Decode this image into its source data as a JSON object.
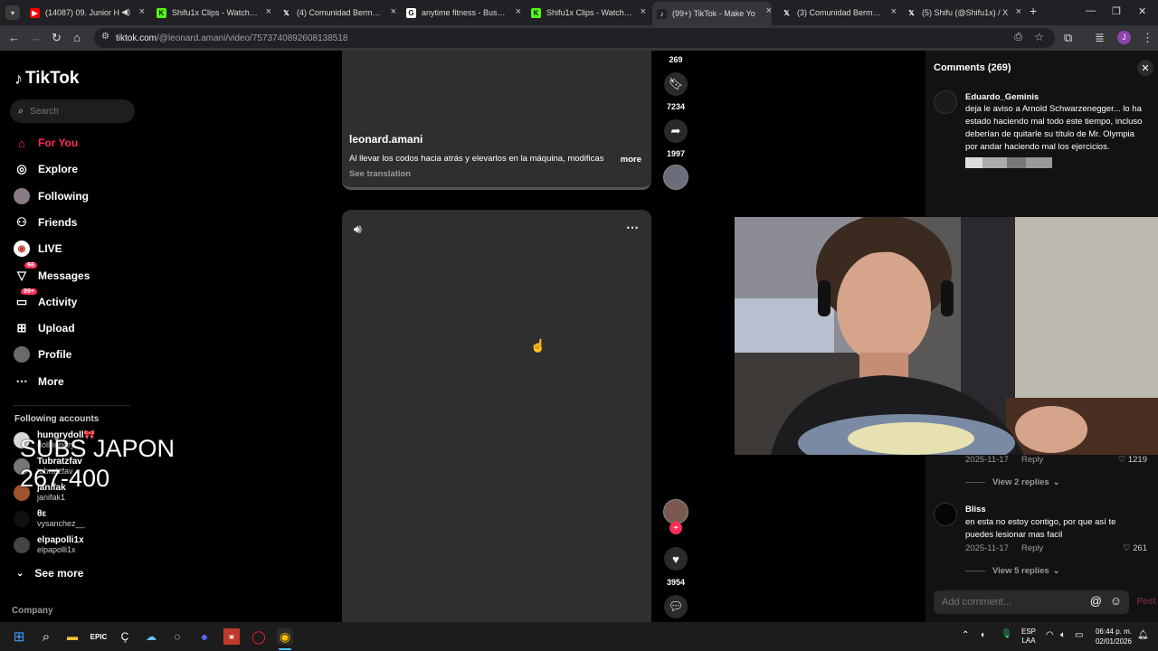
{
  "browser": {
    "tabs": [
      {
        "title": "(14087) 09. Junior H",
        "favicon": "youtube-icon",
        "color": "#ff0000",
        "glyph": "▶",
        "muted": true
      },
      {
        "title": "Shifu1x Clips - Watch Live",
        "favicon": "kick-icon",
        "color": "#53fc18",
        "glyph": "K"
      },
      {
        "title": "(4) Comunidad Bermudez",
        "favicon": "x-icon",
        "color": "#202124",
        "glyph": "𝕏"
      },
      {
        "title": "anytime fitness - Buscar c",
        "favicon": "google-icon",
        "color": "#ffffff",
        "glyph": "G"
      },
      {
        "title": "Shifu1x Clips - Watch Live",
        "favicon": "kick-icon",
        "color": "#53fc18",
        "glyph": "K"
      },
      {
        "title": "(99+) TikTok - Make Yo",
        "favicon": "tiktok-icon",
        "color": "#202124",
        "glyph": "♪",
        "active": true
      },
      {
        "title": "(3) Comunidad Bermudez",
        "favicon": "x-icon",
        "color": "#202124",
        "glyph": "𝕏"
      },
      {
        "title": "(5) Shifu (@Shifu1x) / X",
        "favicon": "x-icon",
        "color": "#202124",
        "glyph": "𝕏"
      }
    ],
    "url_host": "tiktok.com",
    "url_path": "/@leonard.amani/video/7573740892608138518",
    "profile_initial": "J"
  },
  "sidebar": {
    "logo": "TikTok",
    "search_placeholder": "Search",
    "nav": [
      {
        "label": "For You",
        "icon": "home-icon",
        "glyph": "⌂",
        "active": true
      },
      {
        "label": "Explore",
        "icon": "compass-icon",
        "glyph": "◎"
      },
      {
        "label": "Following",
        "icon": "following-avatar-icon",
        "glyph": "●"
      },
      {
        "label": "Friends",
        "icon": "friends-icon",
        "glyph": "⚇"
      },
      {
        "label": "LIVE",
        "icon": "live-icon",
        "glyph": "◉"
      },
      {
        "label": "Messages",
        "icon": "messages-icon",
        "glyph": "▽",
        "badge": "66"
      },
      {
        "label": "Activity",
        "icon": "activity-icon",
        "glyph": "▭",
        "badge": "99+"
      },
      {
        "label": "Upload",
        "icon": "upload-icon",
        "glyph": "⊞"
      },
      {
        "label": "Profile",
        "icon": "profile-icon",
        "glyph": "●"
      },
      {
        "label": "More",
        "icon": "more-icon",
        "glyph": "⋯"
      }
    ],
    "following_heading": "Following accounts",
    "accounts": [
      {
        "name": "hungrydoll🎀",
        "username": "dollhungry"
      },
      {
        "name": "Tubratzfav",
        "username": "tubratzfav"
      },
      {
        "name": "janifak",
        "username": "janifak1"
      },
      {
        "name": "θε",
        "username": "vysanchez__"
      },
      {
        "name": "elpapolli1x",
        "username": "elpapolli1x"
      }
    ],
    "see_more": "See more",
    "company": "Company",
    "overlay_line1": "SUBS JAPON",
    "overlay_line2": "267-400"
  },
  "feed": {
    "post1": {
      "author": "leonard.amani",
      "caption": "Al llevar los codos hacia atrás y elevarlos en la máquina, modificas",
      "more": "more",
      "see_translation": "See translation"
    },
    "rail_top": {
      "count_top": "269",
      "bookmarks": "7234",
      "shares": "1997"
    },
    "rail_bottom": {
      "likes": "3954"
    }
  },
  "comments": {
    "title": "Comments (269)",
    "items": [
      {
        "user": "Eduardo_Geminis",
        "text": "deja le aviso a Arnold Schwarzenegger... lo ha estado haciendo mal todo este tiempo, incluso deberían de quitarle su título de Mr. Olympia por andar haciendo mal los ejercicios."
      },
      {
        "date": "2025-11-17",
        "reply": "Reply",
        "likes": "1219",
        "view_replies": "View 2 replies"
      },
      {
        "user": "Bliss",
        "text": "en esta no estoy contigo, por que así te puedes lesionar mas facil",
        "date": "2025-11-17",
        "reply": "Reply",
        "likes": "261",
        "view_replies": "View 5 replies"
      }
    ],
    "add_placeholder": "Add comment...",
    "post_label": "Post"
  },
  "taskbar": {
    "lang1": "ESP",
    "lang2": "LAA",
    "time": "06:44 p. m.",
    "date": "02/01/2026"
  }
}
